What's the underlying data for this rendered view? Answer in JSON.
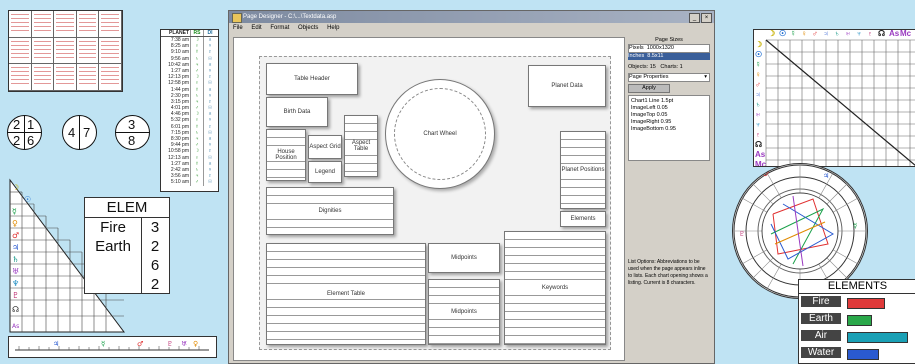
{
  "window": {
    "title": "Page Designer - C:\\...\\Textdata.asp",
    "menu": [
      "File",
      "Edit",
      "Format",
      "Objects",
      "Help"
    ]
  },
  "canvas": {
    "blocks": {
      "chart_wheel": "Chart Wheel",
      "table_header": "Table Header",
      "birth_data": "Birth Data",
      "house_position": "House Position",
      "aspect_grid": "Aspect Grid",
      "aspect_table": "Aspect Table",
      "planet_data": "Planet Data",
      "legend": "Legend",
      "planet_positions": "Planet Positions",
      "elements": "Elements",
      "dignities": "Dignities",
      "element_table": "Element Table",
      "midpoints": "Midpoints",
      "keywords": "Keywords"
    }
  },
  "panel": {
    "heading": "Page Sizes",
    "pixels_label": "Pixels",
    "pixels_value": "1000x1320",
    "inches_label": "Inches",
    "inches_value": "8.5x11",
    "objects_label": "Objects: 15",
    "charts_label": "Charts: 1",
    "dropdown": "Page Properties",
    "button": "Apply",
    "props": [
      "Chart1 Line   1.5pt",
      "ImageLeft   0.05",
      "ImageTop   0.05",
      "ImageRight   0.95",
      "ImageBottom   0.95"
    ],
    "help_text": "List Options: Abbreviations to be used when the page appears inline to lists. Each chart opening shows a listing. Current is 8 characters."
  },
  "planet_table": {
    "headers": [
      "PLANET",
      "RS",
      "DI"
    ],
    "times": [
      "7:38 am",
      "8:25 am",
      "9:10 am",
      "9:56 am",
      "10:42 am",
      "1:27 am",
      "12:13 pm",
      "12:58 pm",
      "1:44 pm",
      "2:30 pm",
      "3:15 pm",
      "4:01 pm",
      "4:46 pm",
      "5:32 pm",
      "6:01 pm",
      "7:15 pm",
      "8:30 pm",
      "9:44 pm",
      "10:58 pm",
      "12:13 am",
      "1:27 am",
      "2:42 am",
      "3:56 am",
      "5:10 am"
    ]
  },
  "left_circles": {
    "c1": [
      "2",
      "1",
      "2",
      "6"
    ],
    "c2": [
      "4",
      "7"
    ],
    "c3": [
      "3",
      "8"
    ]
  },
  "elem_table": {
    "title": "ELEM",
    "rows": [
      {
        "name": "Fire",
        "value": "3"
      },
      {
        "name": "Earth",
        "value": "2"
      },
      {
        "name": "",
        "value": "6"
      },
      {
        "name": "",
        "value": "2"
      }
    ]
  },
  "elements_right": {
    "title": "ELEMENTS",
    "rows": [
      {
        "name": "Fire",
        "value": 0.55,
        "color": "#e03a3a"
      },
      {
        "name": "Earth",
        "value": 0.35,
        "color": "#2aa84a"
      },
      {
        "name": "Air",
        "value": 0.9,
        "color": "#1aa0b5"
      },
      {
        "name": "Water",
        "value": 0.45,
        "color": "#2a5ad0"
      }
    ]
  },
  "right_grid": {
    "symbols": [
      "☽",
      "☉",
      "☿",
      "♀",
      "♂",
      "♃",
      "♄",
      "♅",
      "♆",
      "♇",
      "☊",
      "As",
      "Mc"
    ]
  },
  "colors": {
    "background": "#bfe3f3"
  }
}
